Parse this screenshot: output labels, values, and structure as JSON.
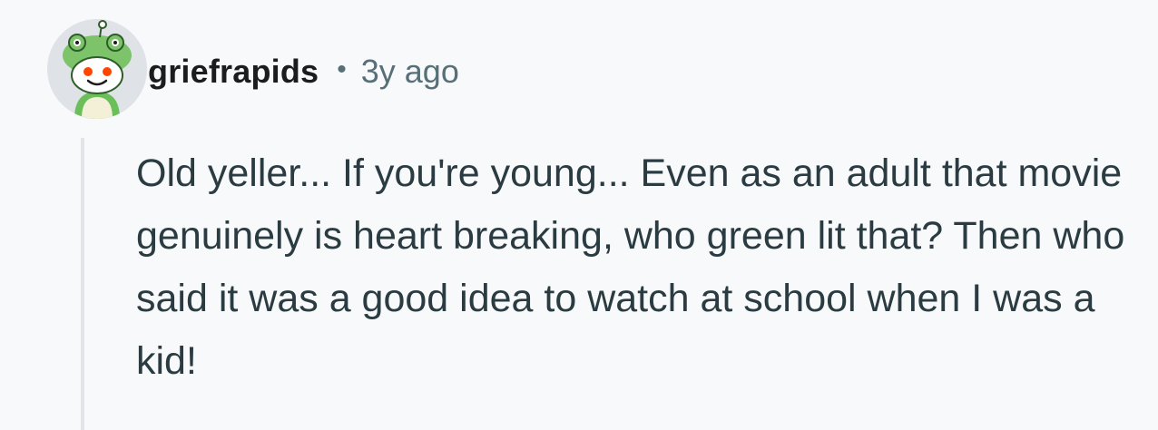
{
  "comment": {
    "username": "griefrapids",
    "separator": "•",
    "timestamp": "3y ago",
    "avatar_icon": "snoo-frog-hat-avatar-icon",
    "body": "Old yeller... If you're young... Even as an adult that movie genuinely is heart breaking, who green lit that? Then who said it was a good idea to watch at school when I was a kid!"
  },
  "colors": {
    "background": "#f8f9fb",
    "username": "#1c1c1c",
    "meta": "#576f76",
    "body_text": "#2a3c42",
    "thread_line": "#e1e5ea",
    "avatar_green": "#7cc36a"
  }
}
